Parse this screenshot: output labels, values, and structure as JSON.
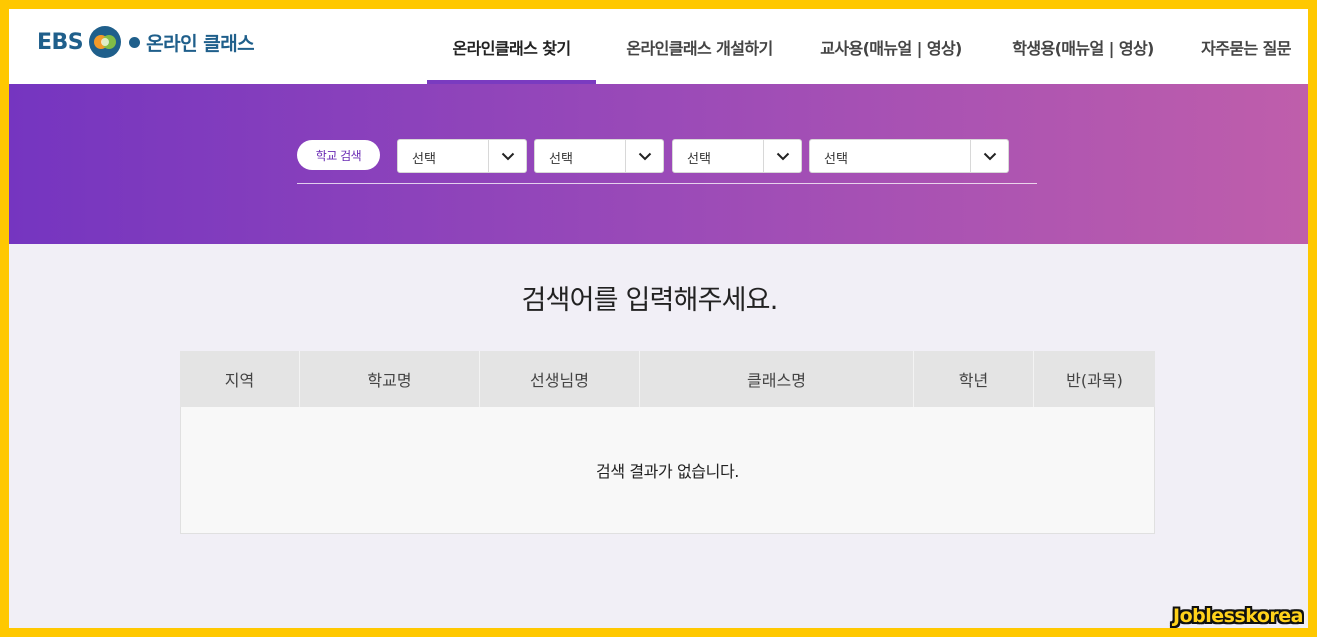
{
  "header": {
    "logo": {
      "brand": "EBS",
      "service": "온라인 클래스"
    },
    "nav": [
      {
        "label": "온라인클래스 찾기",
        "active": true
      },
      {
        "label": "온라인클래스 개설하기",
        "active": false
      },
      {
        "label": "교사용(매뉴얼 | 영상)",
        "active": false
      },
      {
        "label": "학생용(매뉴얼 | 영상)",
        "active": false
      },
      {
        "label": "자주묻는 질문",
        "active": false
      }
    ]
  },
  "search": {
    "button_label": "학교 검색",
    "selects": [
      {
        "value": "선택",
        "icon": "chevron-down-icon"
      },
      {
        "value": "선택",
        "icon": "chevron-down-icon"
      },
      {
        "value": "선택",
        "icon": "chevron-down-icon"
      },
      {
        "value": "선택",
        "icon": "chevron-down-icon"
      }
    ]
  },
  "main": {
    "prompt": "검색어를 입력해주세요.",
    "table": {
      "columns": [
        "지역",
        "학교명",
        "선생님명",
        "클래스명",
        "학년",
        "반(과목)"
      ],
      "empty_message": "검색 결과가 없습니다."
    }
  },
  "watermark": "Joblesskorea",
  "colors": {
    "brand_blue": "#1f5f8b",
    "accent_purple": "#7a3bc0",
    "banner_start": "#7535c0",
    "banner_end": "#bf5eab",
    "frame_yellow": "#ffc800"
  }
}
